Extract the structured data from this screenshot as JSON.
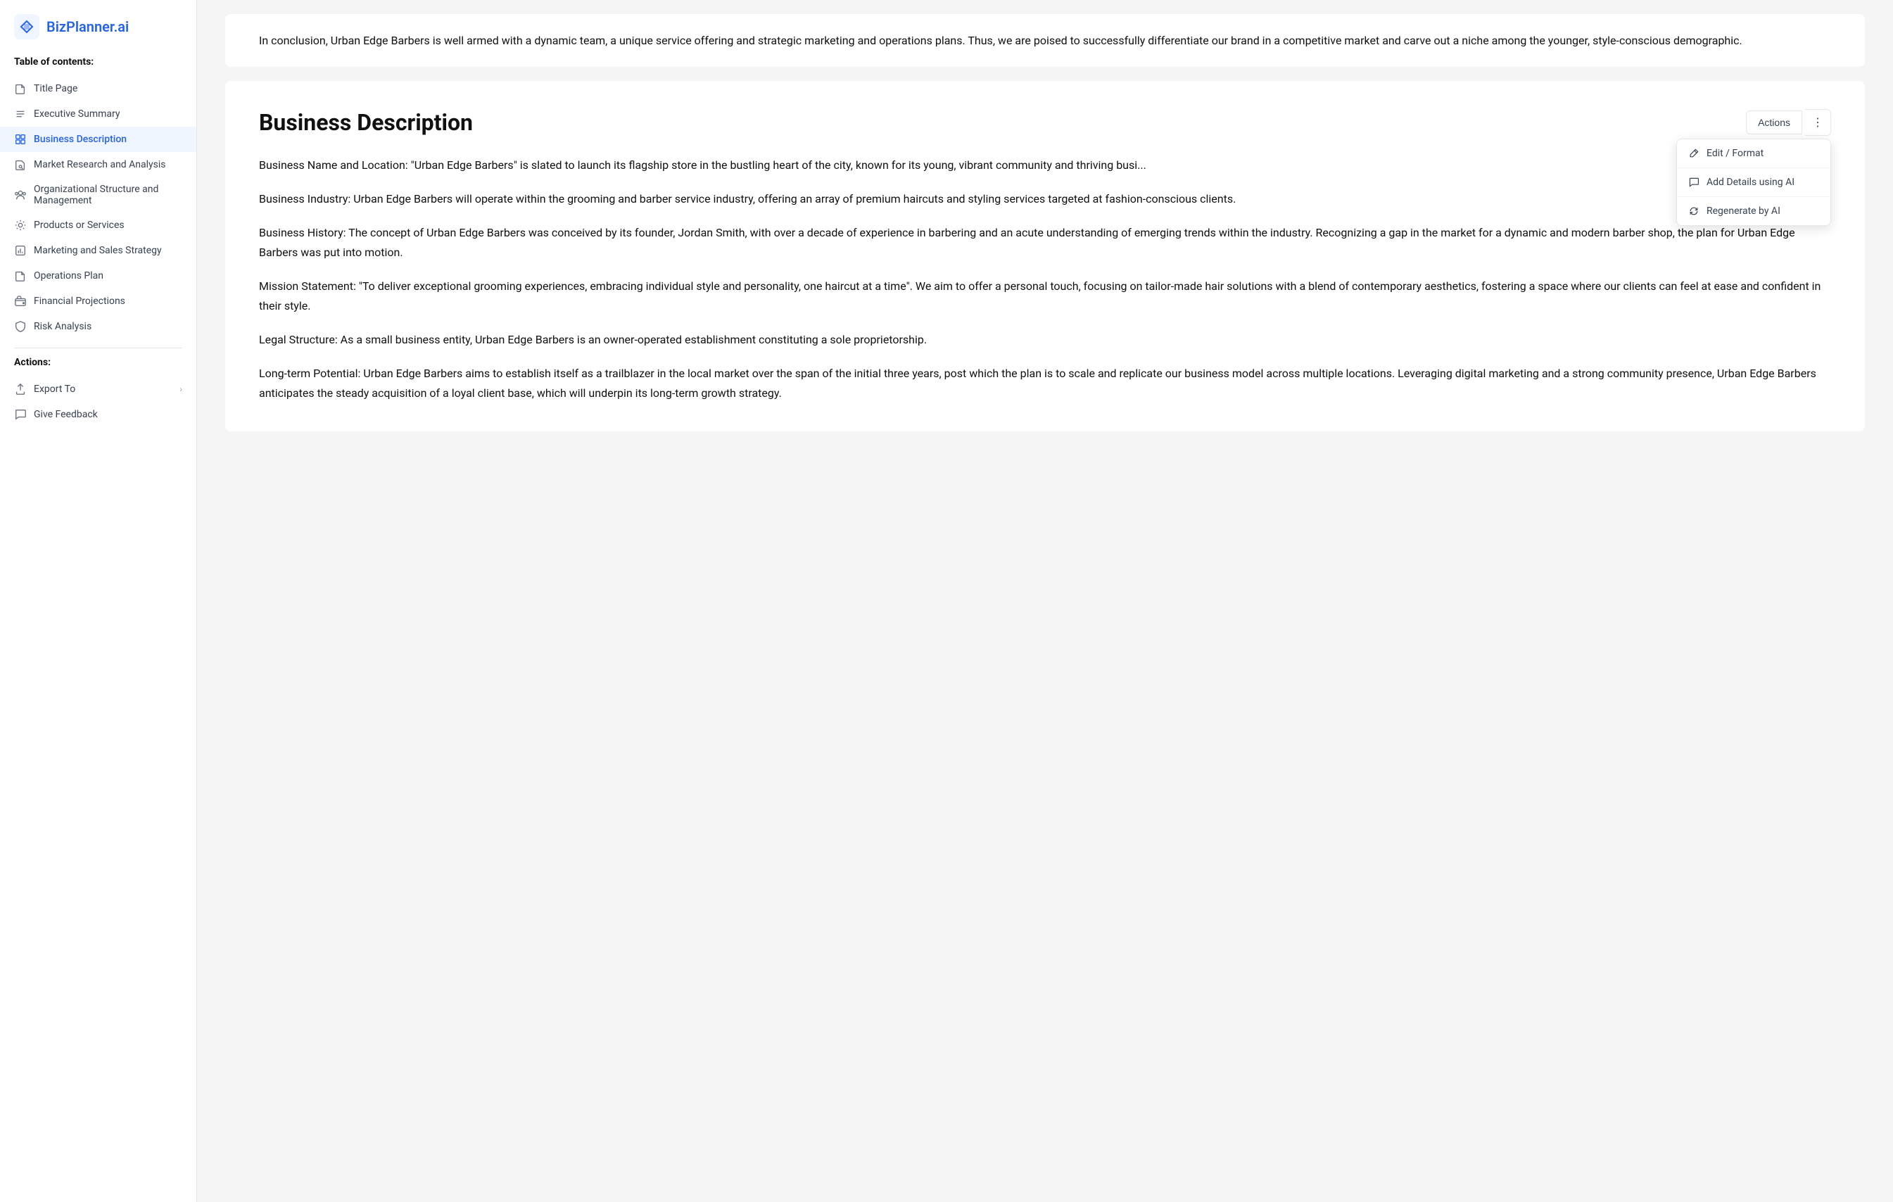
{
  "brand": {
    "name": "BizPlanner",
    "suffix": ".ai"
  },
  "sidebar": {
    "toc_label": "Table of contents:",
    "items": [
      {
        "id": "title-page",
        "label": "Title Page",
        "icon": "document-icon",
        "active": false
      },
      {
        "id": "executive-summary",
        "label": "Executive Summary",
        "icon": "list-icon",
        "active": false
      },
      {
        "id": "business-description",
        "label": "Business Description",
        "icon": "grid-icon",
        "active": true
      },
      {
        "id": "market-research",
        "label": "Market Research and Analysis",
        "icon": "document-search-icon",
        "active": false
      },
      {
        "id": "org-structure",
        "label": "Organizational Structure and Management",
        "icon": "people-icon",
        "active": false
      },
      {
        "id": "products-services",
        "label": "Products or Services",
        "icon": "settings-icon",
        "active": false
      },
      {
        "id": "marketing-sales",
        "label": "Marketing and Sales Strategy",
        "icon": "chart-icon",
        "active": false
      },
      {
        "id": "operations-plan",
        "label": "Operations Plan",
        "icon": "document-icon",
        "active": false
      },
      {
        "id": "financial-projections",
        "label": "Financial Projections",
        "icon": "wallet-icon",
        "active": false
      },
      {
        "id": "risk-analysis",
        "label": "Risk Analysis",
        "icon": "shield-icon",
        "active": false
      }
    ],
    "actions_label": "Actions:",
    "action_items": [
      {
        "id": "export-to",
        "label": "Export To",
        "has_chevron": true,
        "icon": "export-icon"
      },
      {
        "id": "give-feedback",
        "label": "Give Feedback",
        "has_chevron": false,
        "icon": "feedback-icon"
      }
    ]
  },
  "top_section": {
    "text": "In conclusion, Urban Edge Barbers is well armed with a dynamic team, a unique service offering and strategic marketing and operations plans. Thus, we are poised to successfully differentiate our brand in a competitive market and carve out a niche among the younger, style-conscious demographic."
  },
  "main_section": {
    "title": "Business Description",
    "actions_btn_label": "Actions",
    "dropdown": {
      "items": [
        {
          "id": "edit-format",
          "label": "Edit / Format",
          "icon": "edit-icon"
        },
        {
          "id": "add-details-ai",
          "label": "Add Details using AI",
          "icon": "chat-icon"
        },
        {
          "id": "regenerate-ai",
          "label": "Regenerate by AI",
          "icon": "refresh-icon"
        }
      ]
    },
    "paragraphs": [
      "Business Name and Location: \"Urban Edge Barbers\" is slated to launch its flagship store in the bustling heart of the city, known for its young, vibrant community and thriving busi...",
      "Business Industry: Urban Edge Barbers will operate within the grooming and barber service industry, offering an array of premium haircuts and styling services targeted at fashion-conscious clients.",
      "Business History: The concept of Urban Edge Barbers was conceived by its founder, Jordan Smith, with over a decade of experience in barbering and an acute understanding of emerging trends within the industry. Recognizing a gap in the market for a dynamic and modern barber shop, the plan for Urban Edge Barbers was put into motion.",
      "Mission Statement: \"To deliver exceptional grooming experiences, embracing individual style and personality, one haircut at a time\". We aim to offer a personal touch, focusing on tailor-made hair solutions with a blend of contemporary aesthetics, fostering a space where our clients can feel at ease and confident in their style.",
      "Legal Structure: As a small business entity, Urban Edge Barbers is an owner-operated establishment constituting a sole proprietorship.",
      "Long-term Potential: Urban Edge Barbers aims to establish itself as a trailblazer in the local market over the span of the initial three years, post which the plan is to scale and replicate our business model across multiple locations. Leveraging digital marketing and a strong community presence, Urban Edge Barbers anticipates the steady acquisition of a loyal client base, which will underpin its long-term growth strategy."
    ]
  }
}
